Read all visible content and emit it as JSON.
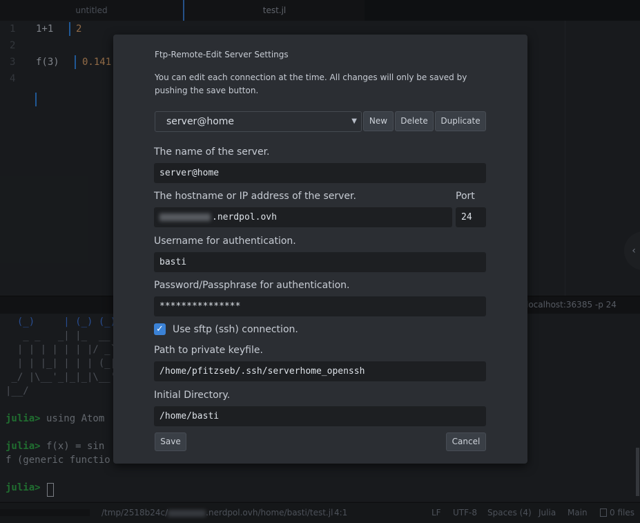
{
  "tabs": [
    {
      "label": "untitled"
    },
    {
      "label": "test.jl"
    }
  ],
  "editor": {
    "line_numbers": [
      "1",
      "2",
      "3",
      "4"
    ],
    "lines": [
      {
        "code": "1+1",
        "result": "2"
      },
      {
        "code": "",
        "result": ""
      },
      {
        "code": "f(3)",
        "result": "0.141"
      },
      {
        "code": "",
        "result": ""
      }
    ]
  },
  "terminal": {
    "title": "localhost:36385 -p 24",
    "logo_lines": [
      "  (_)     | (_) (_)",
      "   _ _   _| |_  __ _",
      "  | | | | | | |/ _` |",
      "  | | |_| | | | (_| |",
      " _/ |\\__'_|_|_|\\__'_|",
      "|__/"
    ],
    "prompt": "julia>",
    "history": [
      {
        "input": " using Atom",
        "output": ""
      },
      {
        "input": " f(x) = sin",
        "output": "f (generic functio"
      }
    ]
  },
  "status": {
    "path_prefix": "/tmp/2518b24c/",
    "path_suffix": ".nerdpol.ovh/home/basti/test.jl",
    "cursor_pos": "4:1",
    "line_ending": "LF",
    "encoding": "UTF-8",
    "indent": "Spaces (4)",
    "grammar": "Julia",
    "module": "Main",
    "files": "0 files"
  },
  "modal": {
    "title": "Ftp-Remote-Edit Server Settings",
    "description": "You can edit each connection at the time. All changes will only be saved by pushing the save button.",
    "server_select": "server@home",
    "new_label": "New",
    "delete_label": "Delete",
    "duplicate_label": "Duplicate",
    "name_label": "The name of the server.",
    "name_value": "server@home",
    "host_label": "The hostname or IP address of the server.",
    "host_value": ".nerdpol.ovh",
    "port_label": "Port",
    "port_value": "24",
    "user_label": "Username for authentication.",
    "user_value": "basti",
    "password_label": "Password/Passphrase for authentication.",
    "password_value": "***************",
    "sftp_label": "Use sftp (ssh) connection.",
    "sftp_checked": true,
    "keyfile_label": "Path to private keyfile.",
    "keyfile_value": "/home/pfitzseb/.ssh/serverhome_openssh",
    "dir_label": "Initial Directory.",
    "dir_value": "/home/basti",
    "save_label": "Save",
    "cancel_label": "Cancel"
  },
  "colors": {
    "accent": "#3b82d6",
    "prompt": "#2e9e46",
    "result": "#d19a66"
  }
}
